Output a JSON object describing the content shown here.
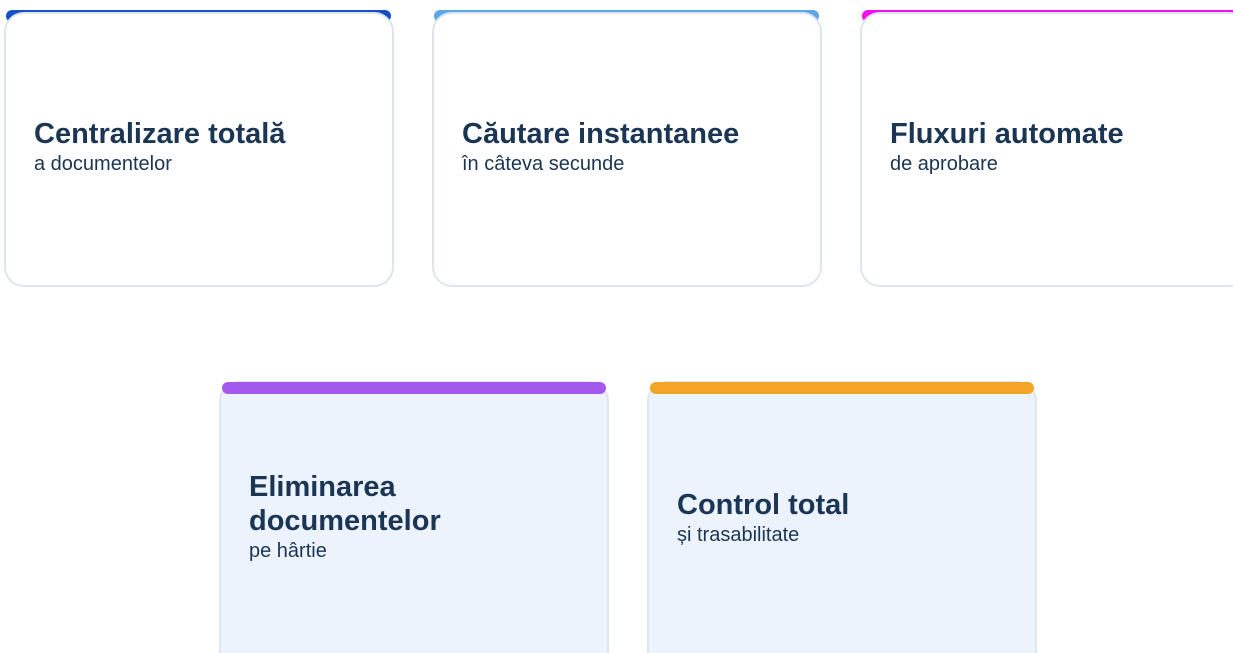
{
  "features": [
    {
      "title": "Centralizare totală",
      "subtitle": "a documentelor",
      "accent_color": "#1650c4"
    },
    {
      "title": "Căutare instantanee",
      "subtitle": "în câteva secunde",
      "accent_color": "#5aa8ea"
    },
    {
      "title": "Fluxuri automate",
      "subtitle": "de aprobare",
      "accent_color": "#f20ff2"
    },
    {
      "title": "Eliminarea documentelor",
      "subtitle": "pe hârtie",
      "accent_color": "#a259ec"
    },
    {
      "title": "Control total",
      "subtitle": "și trasabilitate",
      "accent_color": "#f2a526"
    }
  ]
}
